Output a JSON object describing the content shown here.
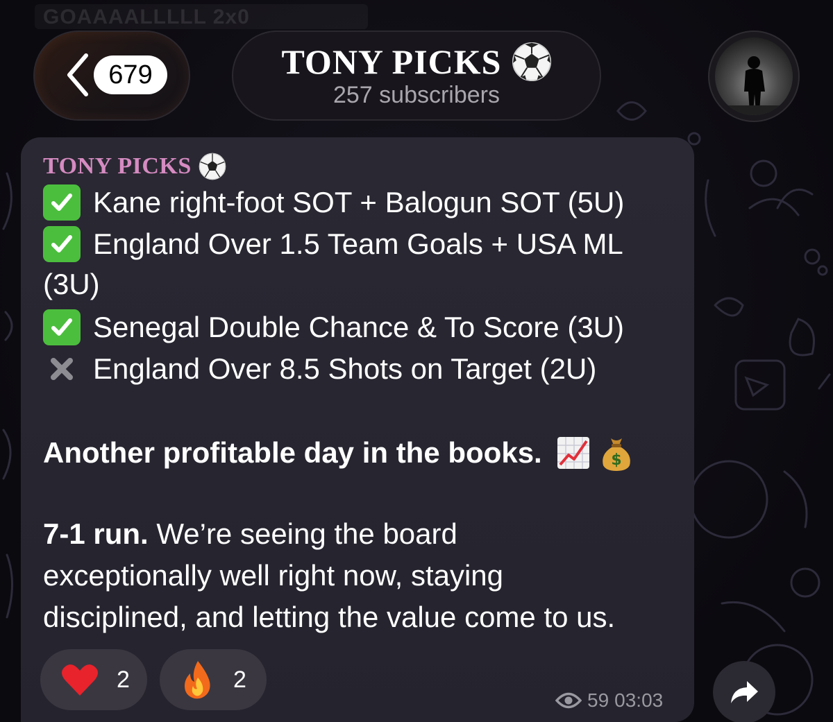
{
  "header": {
    "top_fragment": "GOAAAALLLLL 2x0",
    "back_count": "679",
    "channel_title": "TONY PICKS",
    "subscribers": "257 subscribers",
    "avatar": "profile-silhouette"
  },
  "message": {
    "sender": "TONY PICKS",
    "picks": [
      {
        "status": "check",
        "text": "Kane right-foot SOT + Balogun SOT (5U)"
      },
      {
        "status": "check",
        "text": "England Over 1.5 Team Goals + USA ML",
        "continuation": "(3U)"
      },
      {
        "status": "check",
        "text": "Senegal Double Chance & To Score (3U)"
      },
      {
        "status": "cross",
        "text": "England Over 8.5 Shots on Target (2U)"
      }
    ],
    "headline": "Another profitable day in the books.",
    "run_bold": "7-1 run.",
    "run_rest": " We’re seeing the board",
    "body_line2": "exceptionally well right now, staying",
    "body_line3": "disciplined, and letting the value come to us.",
    "reactions": [
      {
        "emoji": "heart",
        "count": "2"
      },
      {
        "emoji": "fire",
        "count": "2"
      }
    ],
    "views": "59",
    "time": "03:03"
  },
  "colors": {
    "sender": "#d58bc1",
    "check": "#4cbe3e",
    "bubble": "#2a2833"
  }
}
